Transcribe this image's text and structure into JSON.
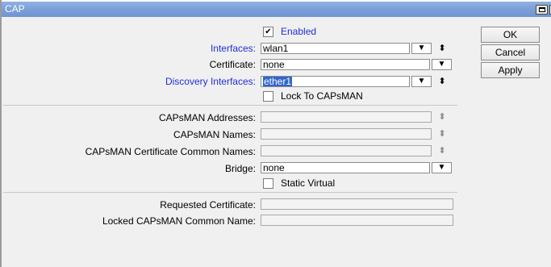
{
  "window": {
    "title": "CAP"
  },
  "enabled": {
    "checked": true,
    "label": "Enabled"
  },
  "interfaces": {
    "label": "Interfaces:",
    "value": "wlan1"
  },
  "certificate": {
    "label": "Certificate:",
    "value": "none"
  },
  "discovery_interfaces": {
    "label": "Discovery Interfaces:",
    "value": "ether1"
  },
  "lock_to_capsman": {
    "checked": false,
    "label": "Lock To CAPsMAN"
  },
  "capsman_addresses": {
    "label": "CAPsMAN Addresses:",
    "value": ""
  },
  "capsman_names": {
    "label": "CAPsMAN Names:",
    "value": ""
  },
  "capsman_cert_names": {
    "label": "CAPsMAN Certificate Common Names:",
    "value": ""
  },
  "bridge": {
    "label": "Bridge:",
    "value": "none"
  },
  "static_virtual": {
    "checked": false,
    "label": "Static Virtual"
  },
  "requested_certificate": {
    "label": "Requested Certificate:",
    "value": ""
  },
  "locked_capsman_name": {
    "label": "Locked CAPsMAN Common Name:",
    "value": ""
  },
  "buttons": {
    "ok": "OK",
    "cancel": "Cancel",
    "apply": "Apply"
  },
  "icons": {
    "dropdown": "dropdown-arrow-icon",
    "updown": "up-down-arrows-icon",
    "check": "checkmark-icon",
    "maximize": "maximize-icon",
    "close": "close-icon"
  },
  "colors": {
    "title_bar": "#7a9fd8",
    "link_label": "#1f2fd6",
    "selection": "#3266cc"
  }
}
